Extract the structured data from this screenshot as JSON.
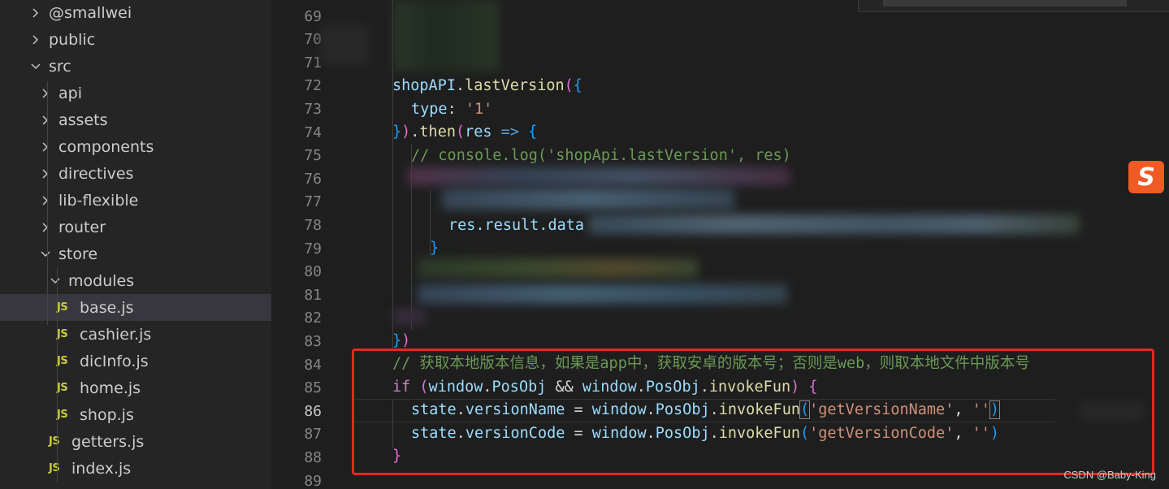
{
  "explorer": {
    "items": [
      {
        "label": "@smallwei",
        "kind": "folder",
        "open": false,
        "depth": 0
      },
      {
        "label": "public",
        "kind": "folder",
        "open": false,
        "depth": 0
      },
      {
        "label": "src",
        "kind": "folder",
        "open": true,
        "depth": 0
      },
      {
        "label": "api",
        "kind": "folder",
        "open": false,
        "depth": 1
      },
      {
        "label": "assets",
        "kind": "folder",
        "open": false,
        "depth": 1
      },
      {
        "label": "components",
        "kind": "folder",
        "open": false,
        "depth": 1
      },
      {
        "label": "directives",
        "kind": "folder",
        "open": false,
        "depth": 1
      },
      {
        "label": "lib-flexible",
        "kind": "folder",
        "open": false,
        "depth": 1
      },
      {
        "label": "router",
        "kind": "folder",
        "open": false,
        "depth": 1
      },
      {
        "label": "store",
        "kind": "folder",
        "open": true,
        "depth": 1
      },
      {
        "label": "modules",
        "kind": "folder",
        "open": true,
        "depth": 2
      },
      {
        "label": "base.js",
        "kind": "js",
        "depth": 3,
        "active": true
      },
      {
        "label": "cashier.js",
        "kind": "js",
        "depth": 3
      },
      {
        "label": "dicInfo.js",
        "kind": "js",
        "depth": 3
      },
      {
        "label": "home.js",
        "kind": "js",
        "depth": 3
      },
      {
        "label": "shop.js",
        "kind": "js",
        "depth": 3
      },
      {
        "label": "getters.js",
        "kind": "js",
        "depth": 2
      },
      {
        "label": "index.js",
        "kind": "js",
        "depth": 2
      }
    ],
    "js_badge": "JS"
  },
  "editor": {
    "current_line": "86",
    "line_numbers": [
      "69",
      "70",
      "71",
      "72",
      "73",
      "74",
      "75",
      "76",
      "77",
      "78",
      "79",
      "80",
      "81",
      "82",
      "83",
      "84",
      "85",
      "86",
      "87",
      "88",
      "89"
    ],
    "code": {
      "l72_obj": "shopAPI",
      "l72_fn": "lastVersion",
      "l73_key": "type",
      "l73_val": "'1'",
      "l74_then": "then",
      "l74_arg": "res",
      "l75_comment": "// console.log('shopApi.lastVersion', res)",
      "l78_text": "res.result.data",
      "l84_comment": "// 获取本地版本信息，如果是app中，获取安卓的版本号；否则是web，则取本地文件中版本号",
      "l85_if": "if",
      "l85_window1": "window",
      "l85_posobj1": "PosObj",
      "l85_window2": "window",
      "l85_posobj2": "PosObj",
      "l85_invoke": "invokeFun",
      "l86_state": "state",
      "l86_prop": "versionName",
      "l86_window": "window",
      "l86_posobj": "PosObj",
      "l86_invoke": "invokeFun",
      "l86_arg": "'getVersionName'",
      "l86_arg2": "''",
      "l87_state": "state",
      "l87_prop": "versionCode",
      "l87_window": "window",
      "l87_posobj": "PosObj",
      "l87_invoke": "invokeFun",
      "l87_arg": "'getVersionCode'",
      "l87_arg2": "''"
    }
  },
  "overlays": {
    "watermark": "CSDN @Baby-King",
    "ime_icon": "sogou-ime-icon",
    "ime_glyph": "S",
    "highlight_color": "#e8261f"
  },
  "colors": {
    "editor_bg": "#1e1e1e",
    "sidebar_bg": "#252526",
    "active_row": "#37373d",
    "keyword": "#569cd6",
    "control": "#c586c0",
    "variable": "#9cdcfe",
    "function": "#dcdcaa",
    "string": "#ce9178",
    "comment": "#6a9955",
    "js_badge": "#cbcb41"
  }
}
